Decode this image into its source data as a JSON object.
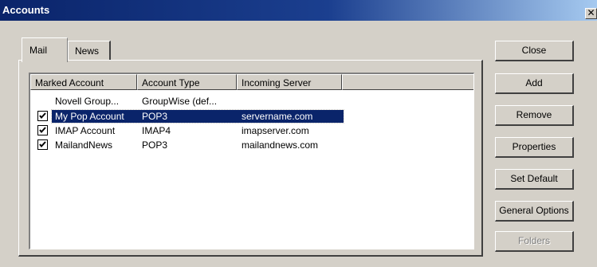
{
  "window": {
    "title": "Accounts",
    "close_glyph": "✕"
  },
  "tabs": [
    {
      "label": "Mail",
      "selected": true
    },
    {
      "label": "News",
      "selected": false
    }
  ],
  "list": {
    "columns": [
      "Marked Account",
      "Account Type",
      "Incoming Server"
    ],
    "rows": [
      {
        "checked": false,
        "account": "Novell Group...",
        "type": "GroupWise (def...",
        "server": "",
        "selected": false
      },
      {
        "checked": true,
        "account": "My Pop Account",
        "type": "POP3",
        "server": "servername.com",
        "selected": true
      },
      {
        "checked": true,
        "account": "IMAP Account",
        "type": "IMAP4",
        "server": "imapserver.com",
        "selected": false
      },
      {
        "checked": true,
        "account": "MailandNews",
        "type": "POP3",
        "server": "mailandnews.com",
        "selected": false
      }
    ]
  },
  "buttons": {
    "close": "Close",
    "add": "Add",
    "remove": "Remove",
    "properties": "Properties",
    "set_default": "Set Default",
    "general_options": "General Options",
    "folders": "Folders"
  },
  "colors": {
    "title_bar": "#0a246a",
    "selection": "#0a246a",
    "face": "#d4d0c8"
  }
}
